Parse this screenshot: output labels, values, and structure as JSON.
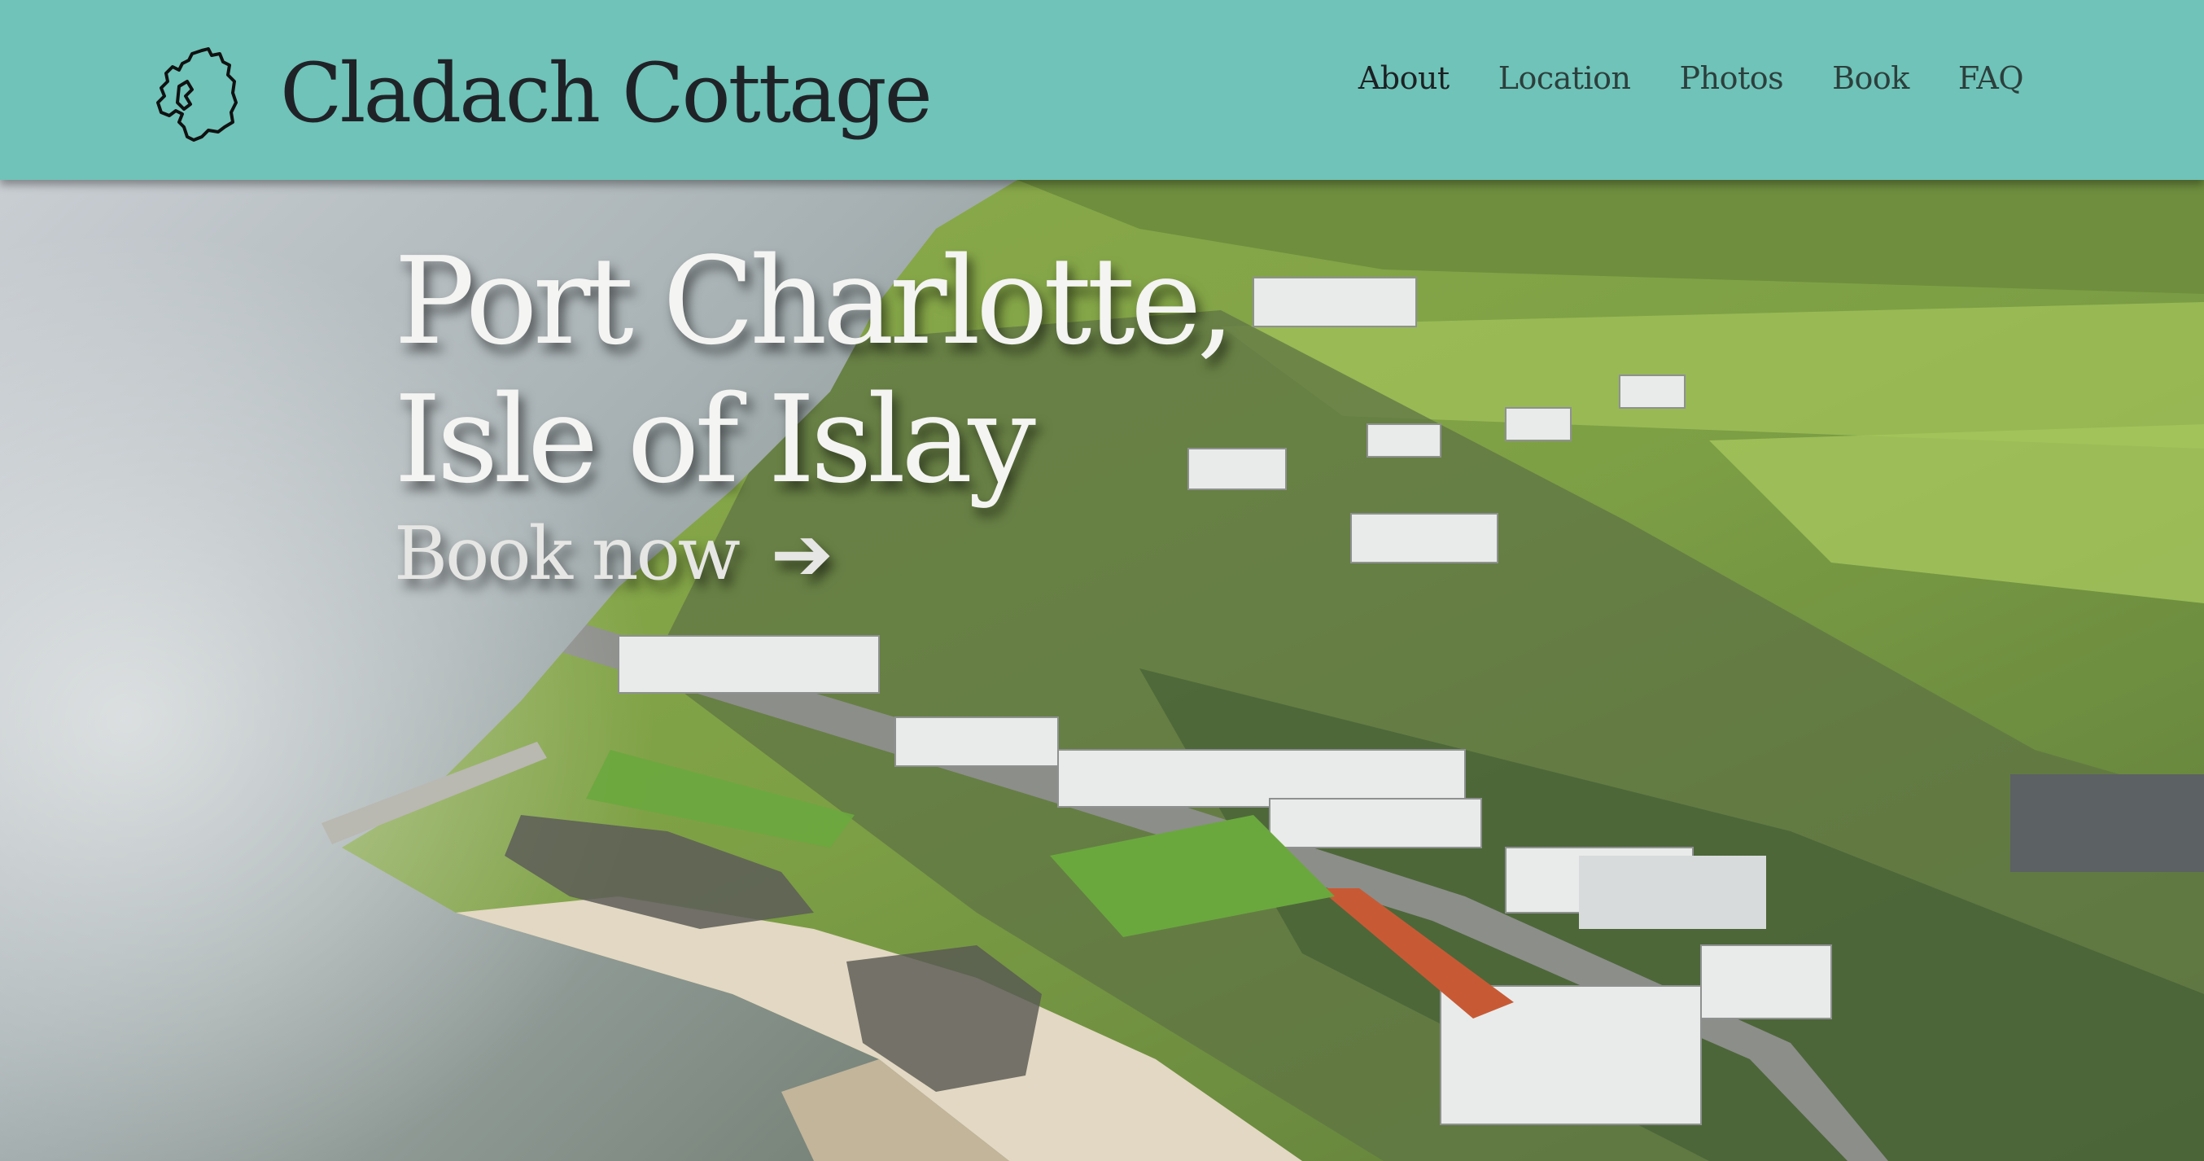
{
  "brand": {
    "logo_icon": "islay-island-outline-icon",
    "title": "Cladach Cottage"
  },
  "nav": {
    "items": [
      {
        "label": "About",
        "active": true
      },
      {
        "label": "Location",
        "active": false
      },
      {
        "label": "Photos",
        "active": false
      },
      {
        "label": "Book",
        "active": false
      },
      {
        "label": "FAQ",
        "active": false
      }
    ]
  },
  "hero": {
    "background": "aerial-photo-of-coastal-village",
    "heading_line1": "Port Charlotte,",
    "heading_line2": "Isle of Islay",
    "cta_label": "Book now",
    "cta_icon": "arrow-right-icon"
  },
  "colors": {
    "header_bg": "#6fc3b8",
    "text_dark": "#1f2328",
    "hero_text": "#f4f4f2"
  }
}
